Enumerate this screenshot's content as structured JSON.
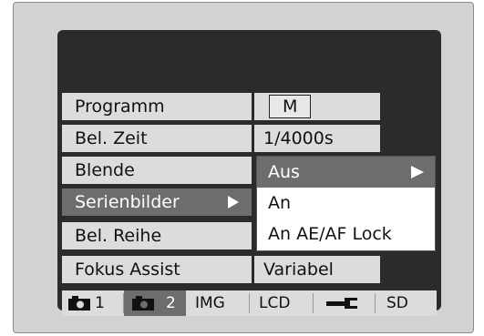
{
  "menu": {
    "rows": [
      {
        "label": "Programm",
        "value": "M"
      },
      {
        "label": "Bel. Zeit",
        "value": "1/4000s"
      },
      {
        "label": "Blende",
        "value": ""
      },
      {
        "label": "Serienbilder",
        "value": ""
      },
      {
        "label": "Bel. Reihe",
        "value": ""
      },
      {
        "label": "Fokus Assist",
        "value": "Variabel"
      }
    ],
    "selected_row": "Serienbilder"
  },
  "submenu": {
    "options": [
      "Aus",
      "An",
      "An AE/AF Lock"
    ],
    "selected": "Aus"
  },
  "tabs": [
    {
      "icon": "camera-icon",
      "label": "1"
    },
    {
      "icon": "camera-icon",
      "label": "2"
    },
    {
      "label": "IMG"
    },
    {
      "label": "LCD"
    },
    {
      "icon": "wrench-icon",
      "label": ""
    },
    {
      "label": "SD"
    }
  ],
  "active_tab": "2",
  "colors": {
    "cell_bg": "#dcdcdc",
    "selected_bg": "#6d6d6d",
    "screen_bg": "#2b2b2b",
    "bezel_bg": "#d2d2d2"
  }
}
